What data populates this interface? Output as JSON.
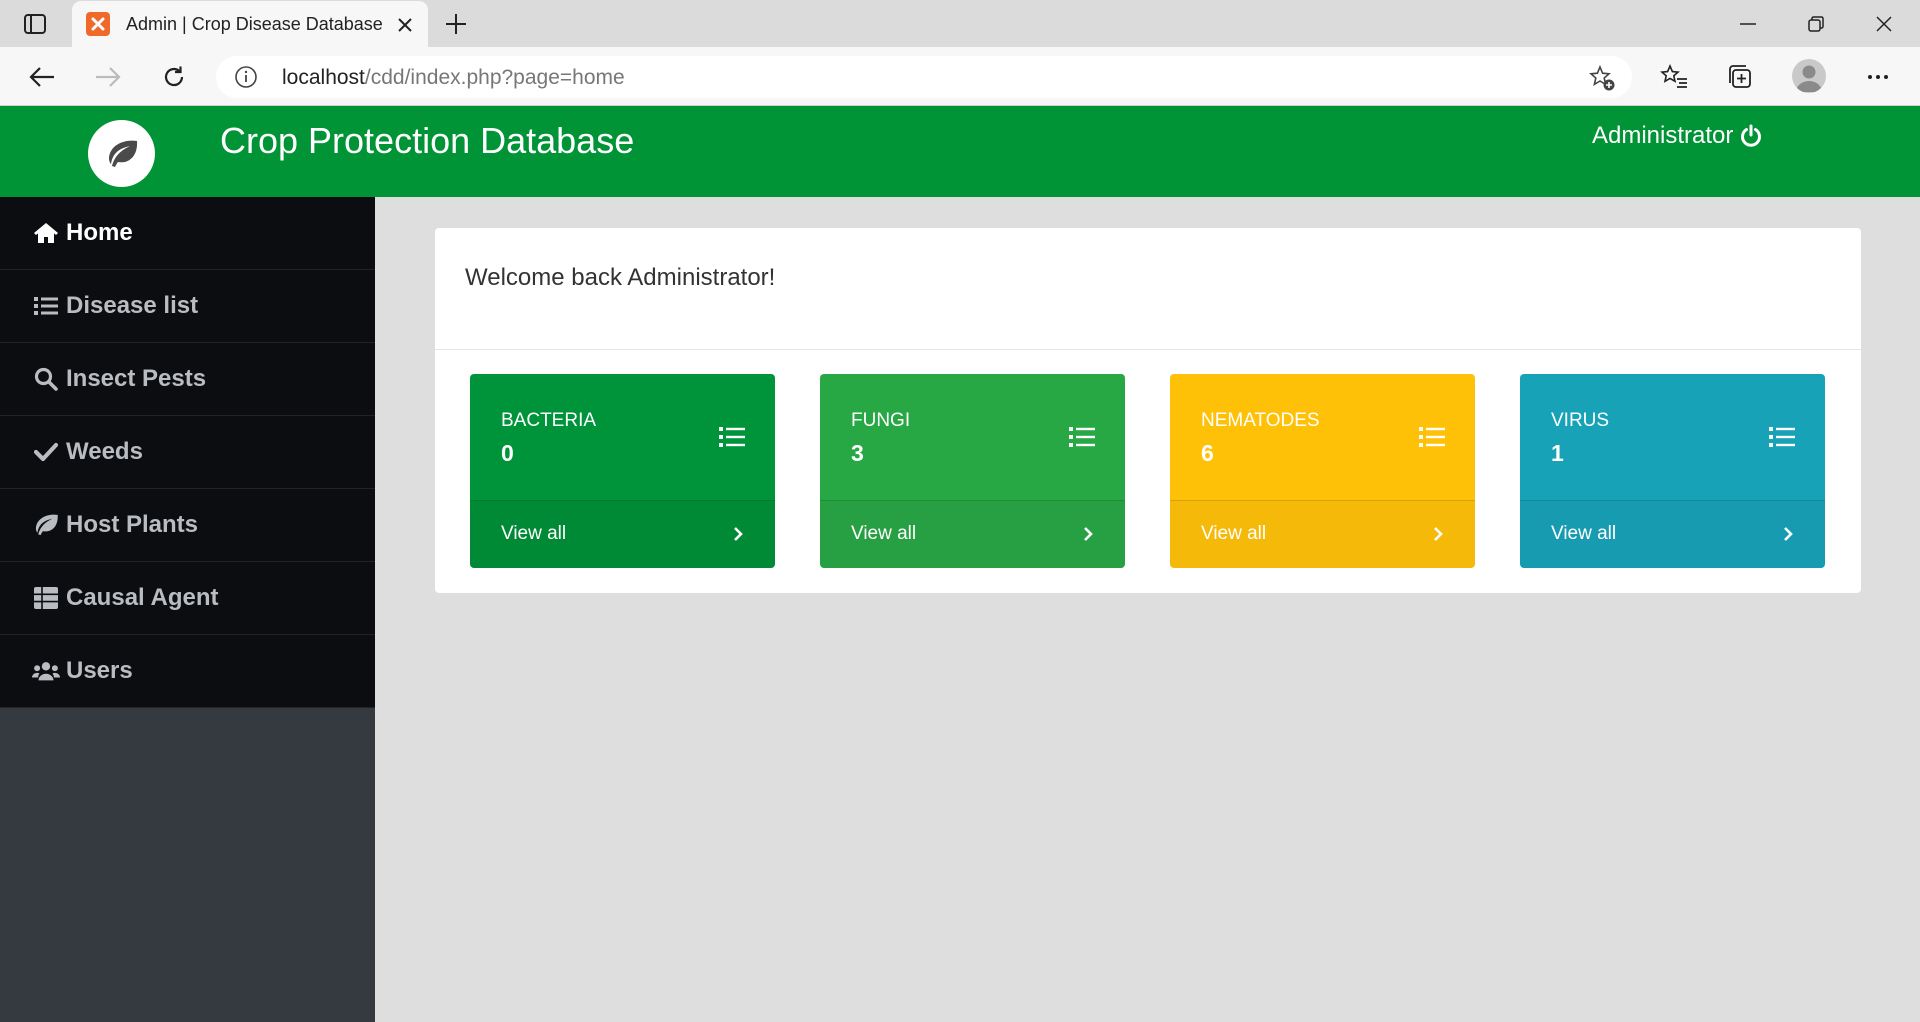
{
  "browser": {
    "tab_title": "Admin | Crop Disease Database",
    "url_host": "localhost",
    "url_path": "/cdd/index.php?page=home"
  },
  "header": {
    "title": "Crop Protection Database",
    "user_name": "Administrator",
    "bg_color": "#009436"
  },
  "sidebar": {
    "items": [
      {
        "label": "Home",
        "icon": "home-icon",
        "active": true
      },
      {
        "label": "Disease list",
        "icon": "list-icon"
      },
      {
        "label": "Insect Pests",
        "icon": "search-icon"
      },
      {
        "label": "Weeds",
        "icon": "check-icon"
      },
      {
        "label": "Host Plants",
        "icon": "leaf-icon"
      },
      {
        "label": "Causal Agent",
        "icon": "table-icon"
      },
      {
        "label": "Users",
        "icon": "users-icon"
      }
    ]
  },
  "main": {
    "welcome": "Welcome back Administrator!",
    "boxes": [
      {
        "label": "BACTERIA",
        "count": "0",
        "link": "View all",
        "color": "#00943a"
      },
      {
        "label": "FUNGI",
        "count": "3",
        "link": "View all",
        "color": "#28a745"
      },
      {
        "label": "NEMATODES",
        "count": "6",
        "link": "View all",
        "color": "#ffc107"
      },
      {
        "label": "VIRUS",
        "count": "1",
        "link": "View all",
        "color": "#17a2b8"
      }
    ]
  }
}
